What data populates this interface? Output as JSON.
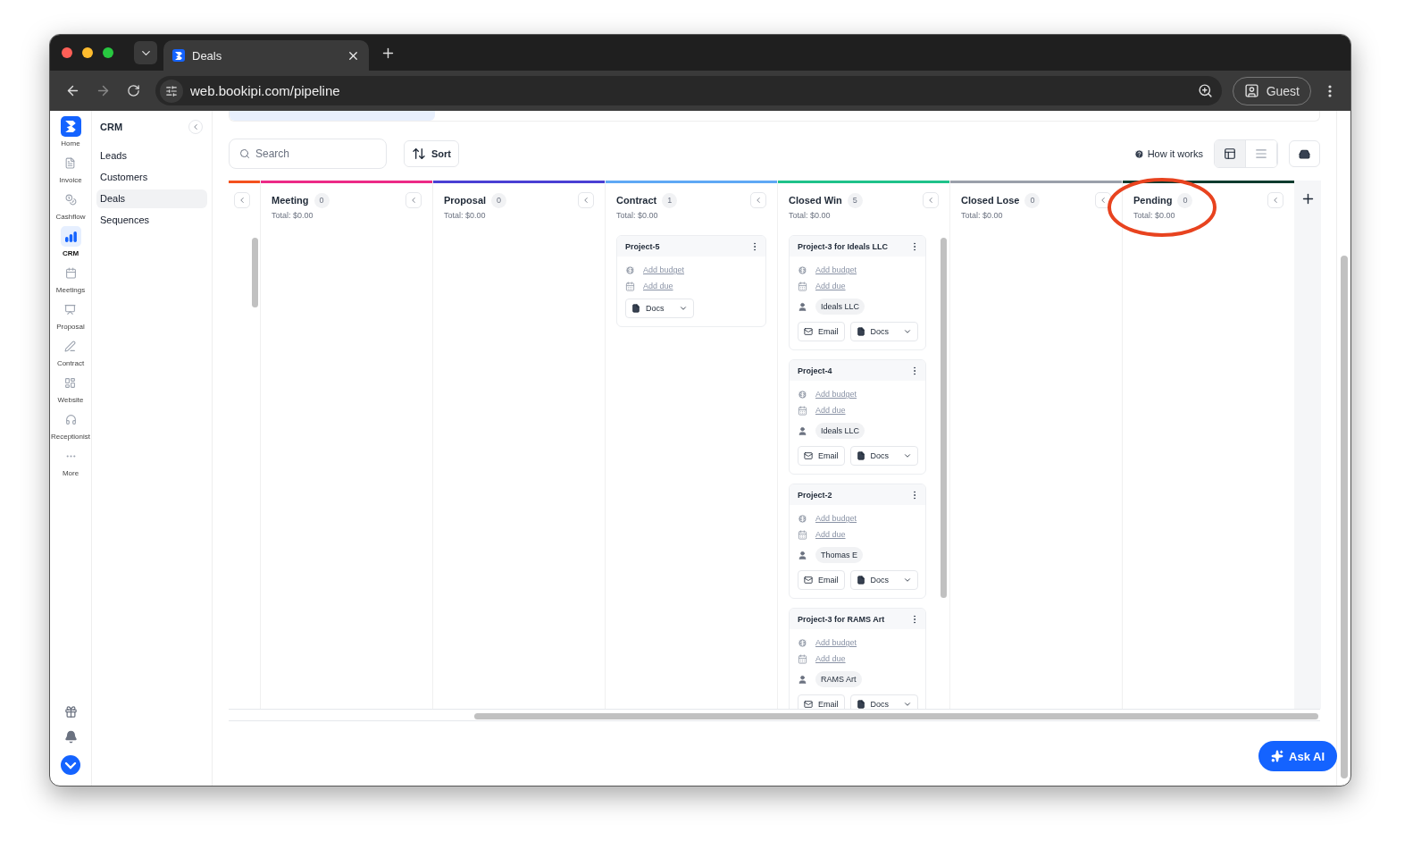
{
  "browser": {
    "tabs": [
      {
        "title": "Deals",
        "selected": true
      }
    ],
    "address": "web.bookipi.com/pipeline",
    "profile": "Guest"
  },
  "rail": {
    "items": [
      {
        "label": "Home",
        "selected": false
      },
      {
        "label": "Invoice",
        "selected": false
      },
      {
        "label": "Cashflow",
        "selected": false
      },
      {
        "label": "CRM",
        "selected": true
      },
      {
        "label": "Meetings",
        "selected": false
      },
      {
        "label": "Proposal",
        "selected": false
      },
      {
        "label": "Contract",
        "selected": false
      },
      {
        "label": "Website",
        "selected": false
      },
      {
        "label": "Receptionist",
        "selected": false
      },
      {
        "label": "More",
        "selected": false
      }
    ]
  },
  "sidebar": {
    "title": "CRM",
    "items": [
      {
        "label": "Leads",
        "selected": false
      },
      {
        "label": "Customers",
        "selected": false
      },
      {
        "label": "Deals",
        "selected": true
      },
      {
        "label": "Sequences",
        "selected": false
      }
    ]
  },
  "toolbar": {
    "search": {
      "placeholder": "Search"
    },
    "sort": "Sort",
    "help": "How it works",
    "views": [
      {
        "kind": "board",
        "selected": true
      },
      {
        "kind": "list",
        "selected": false
      }
    ]
  },
  "board": {
    "leading_column": {
      "color": "#f4511e"
    },
    "columns": [
      {
        "name": "Meeting",
        "count": "0",
        "total": "Total: $0.00",
        "color": "#ec2a86"
      },
      {
        "name": "Proposal",
        "count": "0",
        "total": "Total: $0.00",
        "color": "#4a3fd4"
      },
      {
        "name": "Contract",
        "count": "1",
        "total": "Total: $0.00",
        "color": "#5ea8f5",
        "cards": [
          {
            "title": "Project-5",
            "budget": "Add budget",
            "due": "Add due",
            "docs": "Docs"
          }
        ]
      },
      {
        "name": "Closed Win",
        "count": "5",
        "total": "Total: $0.00",
        "color": "#1fc28a",
        "cards": [
          {
            "title": "Project-3 for Ideals LLC",
            "budget": "Add budget",
            "due": "Add due",
            "contact": "Ideals LLC",
            "email": "Email",
            "docs": "Docs"
          },
          {
            "title": "Project-4",
            "budget": "Add budget",
            "due": "Add due",
            "contact": "Ideals LLC",
            "email": "Email",
            "docs": "Docs"
          },
          {
            "title": "Project-2",
            "budget": "Add budget",
            "due": "Add due",
            "contact": "Thomas E",
            "email": "Email",
            "docs": "Docs"
          },
          {
            "title": "Project-3 for RAMS Art",
            "budget": "Add budget",
            "due": "Add due",
            "contact": "RAMS Art",
            "email": "Email",
            "docs": "Docs"
          }
        ]
      },
      {
        "name": "Closed Lose",
        "count": "0",
        "total": "Total: $0.00",
        "color": "#9aa0aa"
      },
      {
        "name": "Pending",
        "count": "0",
        "total": "Total: $0.00",
        "color": "#0d3b2e",
        "highlighted": true
      }
    ]
  },
  "ask_ai": "Ask AI"
}
